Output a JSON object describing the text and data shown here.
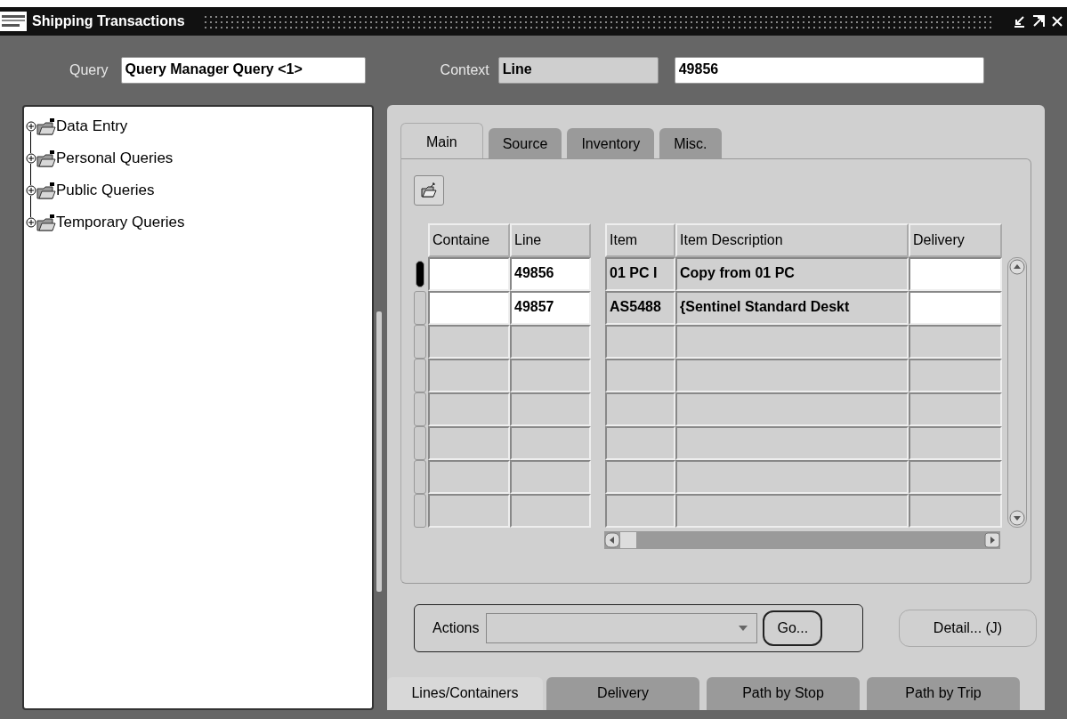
{
  "window": {
    "title": "Shipping Transactions"
  },
  "query": {
    "label": "Query",
    "value": "Query Manager Query <1>"
  },
  "context": {
    "label": "Context",
    "value": "Line",
    "reference": "49856"
  },
  "tree": [
    {
      "label": "Data Entry",
      "expanded": false
    },
    {
      "label": "Personal Queries",
      "expanded": false
    },
    {
      "label": "Public Queries",
      "expanded": false
    },
    {
      "label": "Temporary Queries",
      "expanded": false
    }
  ],
  "tabs": [
    {
      "label": "Main",
      "selected": true
    },
    {
      "label": "Source",
      "selected": false
    },
    {
      "label": "Inventory",
      "selected": false
    },
    {
      "label": "Misc.",
      "selected": false
    }
  ],
  "table": {
    "columns": [
      {
        "label": "Containe",
        "editable": true
      },
      {
        "label": "Line",
        "editable": true
      },
      {
        "label": "Item",
        "editable": false
      },
      {
        "label": "Item Description",
        "editable": false
      },
      {
        "label": "Delivery",
        "editable": true
      }
    ],
    "rows": [
      {
        "selected": true,
        "cells": [
          "",
          "49856",
          "01 PC I",
          "Copy from 01 PC",
          ""
        ]
      },
      {
        "selected": false,
        "cells": [
          "",
          "49857",
          "AS5488",
          "{Sentinel Standard Deskt",
          ""
        ]
      }
    ]
  },
  "actions": {
    "label": "Actions",
    "go": "Go..."
  },
  "detail_button": "Detail... (J)",
  "bottom_tabs": [
    {
      "label": "Lines/Containers",
      "selected": true
    },
    {
      "label": "Delivery",
      "selected": false
    },
    {
      "label": "Path by Stop",
      "selected": false
    },
    {
      "label": "Path by Trip",
      "selected": false
    }
  ]
}
